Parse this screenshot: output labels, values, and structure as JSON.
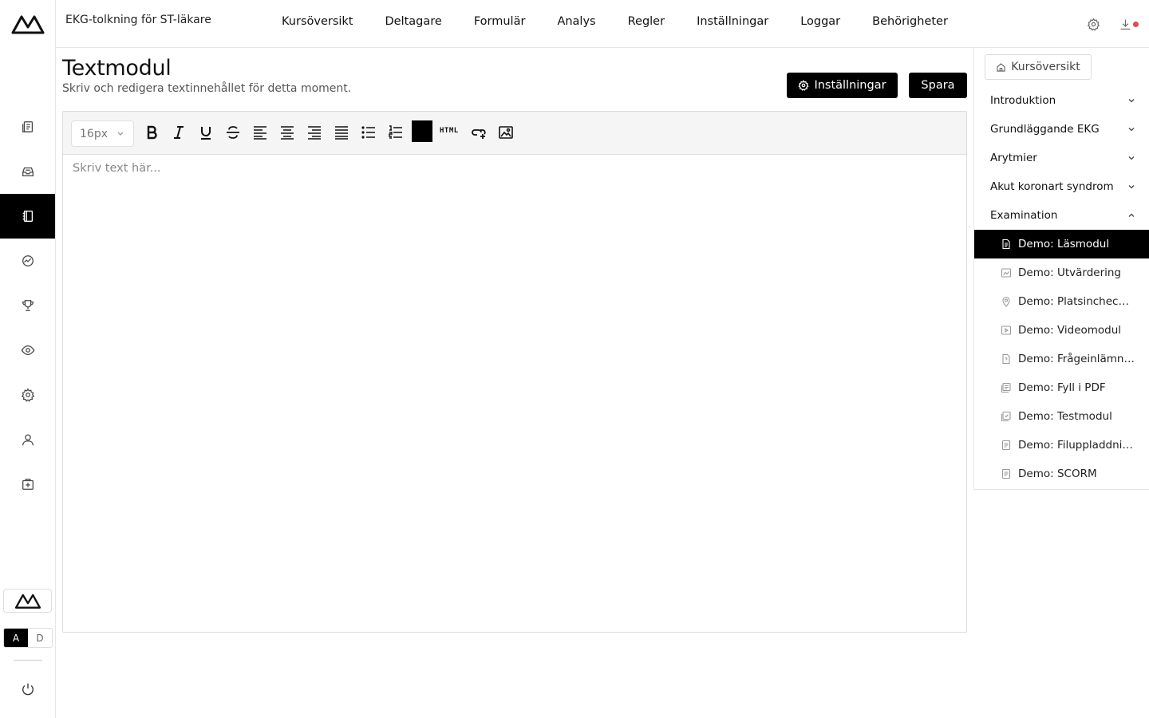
{
  "header": {
    "course_title": "EKG-tolkning för ST-läkare",
    "nav": [
      "Kursöversikt",
      "Deltagare",
      "Formulär",
      "Analys",
      "Regler",
      "Inställningar",
      "Loggar",
      "Behörigheter"
    ]
  },
  "rail": {
    "items": [
      "documents-icon",
      "inbox-icon",
      "notebook-icon",
      "analytics-icon",
      "trophy-icon",
      "eye-icon",
      "gear-icon",
      "user-icon",
      "medical-case-icon"
    ],
    "active_index": 2,
    "toggle": {
      "a": "A",
      "d": "D"
    }
  },
  "main": {
    "title": "Textmodul",
    "subtitle": "Skriv och redigera textinnehållet för detta moment.",
    "settings_button": "Inställningar",
    "save_button": "Spara"
  },
  "editor": {
    "font_size": "16px",
    "placeholder": "Skriv text här...",
    "html_label": "HTML",
    "text_color": "#000000",
    "tools": [
      "bold",
      "italic",
      "underline",
      "strikethrough",
      "align-left",
      "align-center",
      "align-right",
      "justify",
      "bullet-list",
      "numbered-list",
      "text-color",
      "html",
      "link",
      "image"
    ]
  },
  "panel": {
    "overview_button": "Kursöversikt",
    "sections": [
      {
        "label": "Introduktion",
        "expanded": false
      },
      {
        "label": "Grundläggande EKG",
        "expanded": false
      },
      {
        "label": "Arytmier",
        "expanded": false
      },
      {
        "label": "Akut koronart syndrom",
        "expanded": false
      },
      {
        "label": "Examination",
        "expanded": true
      }
    ],
    "modules": [
      {
        "label": "Demo: Läsmodul",
        "icon": "document-icon",
        "active": true
      },
      {
        "label": "Demo: Utvärdering",
        "icon": "chart-icon",
        "active": false
      },
      {
        "label": "Demo: Platsincheckning",
        "icon": "location-pin-icon",
        "active": false
      },
      {
        "label": "Demo: Videomodul",
        "icon": "video-icon",
        "active": false
      },
      {
        "label": "Demo: Frågeinlämning",
        "icon": "question-file-icon",
        "active": false
      },
      {
        "label": "Demo: Fyll i PDF",
        "icon": "pdf-icon",
        "active": false
      },
      {
        "label": "Demo: Testmodul",
        "icon": "test-icon",
        "active": false
      },
      {
        "label": "Demo: Filuppladdning",
        "icon": "upload-file-icon",
        "active": false
      },
      {
        "label": "Demo: SCORM",
        "icon": "package-icon",
        "active": false
      }
    ]
  },
  "colors": {
    "accent": "#000000",
    "notification": "#e5484d",
    "border": "#e6e6e6"
  }
}
